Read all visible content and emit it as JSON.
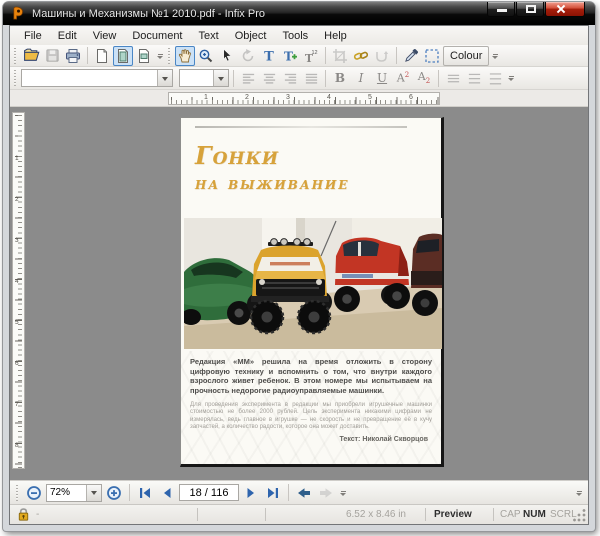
{
  "window": {
    "title": "Машины и Механизмы №1 2010.pdf - Infix Pro"
  },
  "menu": {
    "items": [
      "File",
      "Edit",
      "View",
      "Document",
      "Text",
      "Object",
      "Tools",
      "Help"
    ]
  },
  "toolbars": {
    "colour_label": "Colour",
    "fit_text_badge": "12",
    "glyphs": {
      "bold": "B",
      "italic": "I",
      "underline": "U",
      "script_base": "A",
      "script_mark": "2"
    },
    "icons": {
      "open": "folder-open",
      "save": "floppy-disk",
      "print": "printer",
      "page_single": "page",
      "page_fit": "page-fit",
      "page_width": "page-width",
      "hand": "pan-hand",
      "zoom": "magnifier",
      "select": "arrow-cursor",
      "rotate": "rotate-arrow",
      "text": "text-T",
      "add_text": "text-T-plus",
      "fit_text": "text-T-12",
      "crop": "crop-marks",
      "hyperlink": "chain-link",
      "reflow": "curve-arrow",
      "eyedropper": "eyedropper",
      "marquee": "dashed-selection"
    }
  },
  "rulers": {
    "h": [
      "1",
      "2",
      "3",
      "4",
      "5",
      "6"
    ],
    "v": [
      "1",
      "2",
      "3",
      "4",
      "5",
      "6",
      "7",
      "8"
    ]
  },
  "page": {
    "title_line1": "Гонки",
    "title_line2": "на выживание",
    "intro": "Редакция «ММ» решила на время отложить в сторону цифровую технику и вспомнить о том, что внутри каждого взрослого живет ребенок. В этом номере мы испытываем на прочность недорогие радиоуправляемые машинки.",
    "body": "Для проведения эксперимента в редакции мы приобрели игрушечные машинки стоимостью не более 2000 рублей. Цель эксперимента никакими цифрами не измерялась, ведь главное в игрушке — не скорость и не превращение её в кучу запчастей, а количество радости, которое она может доставить.",
    "byline": "Текст: Николай Скворцов"
  },
  "navbar": {
    "zoom": "72%",
    "page": "18 / 116"
  },
  "statusbar": {
    "dash": "-",
    "page_size": "6.52 x 8.46 in",
    "mode": "Preview",
    "cap": "CAP",
    "num": "NUM",
    "scrl": "SCRL"
  },
  "colors": {
    "titlebar": "#0a0a0a",
    "close_button": "#a71f0c",
    "selected_tool_bg": "#cbe1f6",
    "selected_tool_border": "#4a86c5",
    "doc_background": "#8b8b8b",
    "page_title_orange": "#d7a23a",
    "nav_arrow_blue": "#2e64ad",
    "padlock_gold": "#e2aa1f"
  }
}
